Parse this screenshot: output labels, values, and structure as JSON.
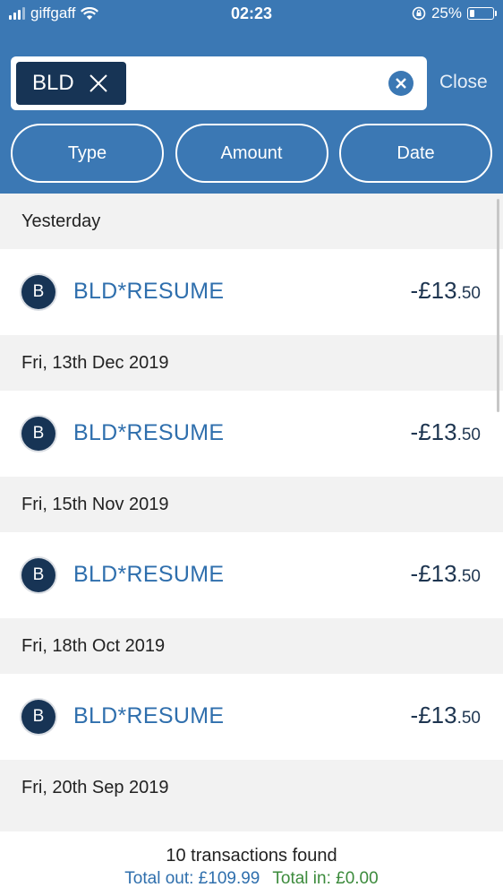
{
  "status_bar": {
    "carrier": "giffgaff",
    "time": "02:23",
    "battery": "25%"
  },
  "search": {
    "chip_label": "BLD",
    "close_label": "Close"
  },
  "filters": [
    "Type",
    "Amount",
    "Date"
  ],
  "groups": [
    {
      "date": "Yesterday",
      "merchant": "BLD*RESUME",
      "initial": "B",
      "amount_major": "-£13",
      "amount_minor": ".50"
    },
    {
      "date": "Fri, 13th Dec 2019",
      "merchant": "BLD*RESUME",
      "initial": "B",
      "amount_major": "-£13",
      "amount_minor": ".50"
    },
    {
      "date": "Fri, 15th Nov 2019",
      "merchant": "BLD*RESUME",
      "initial": "B",
      "amount_major": "-£13",
      "amount_minor": ".50"
    },
    {
      "date": "Fri, 18th Oct 2019",
      "merchant": "BLD*RESUME",
      "initial": "B",
      "amount_major": "-£13",
      "amount_minor": ".50"
    },
    {
      "date": "Fri, 20th Sep 2019"
    }
  ],
  "footer": {
    "count": "10 transactions found",
    "total_out": "Total out: £109.99",
    "total_in": "Total in: £0.00"
  },
  "colors": {
    "header": "#3b78b4",
    "chip": "#173455",
    "merchant": "#2f6fad",
    "total_in": "#3c8b3c"
  }
}
